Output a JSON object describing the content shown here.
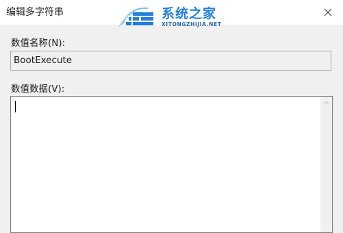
{
  "window": {
    "title": "编辑多字符串",
    "close_icon": "close-icon"
  },
  "watermark": {
    "site_name": "系统之家",
    "site_url": "XITONGZHIJIA.NET",
    "brand_color": "#1f7fd9"
  },
  "value_name": {
    "label": "数值名称(N):",
    "value": "BootExecute"
  },
  "value_data": {
    "label": "数值数据(V):",
    "value": ""
  },
  "scrollbar": {
    "up_icon": "scroll-up-arrow-icon"
  }
}
